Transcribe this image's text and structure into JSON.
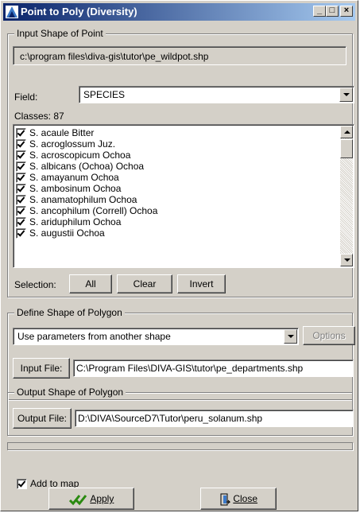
{
  "window": {
    "title": "Point to Poly  (Diversity)",
    "minimize": "_",
    "maximize": "□",
    "close": "×"
  },
  "input_point": {
    "legend": "Input Shape of Point",
    "path": "c:\\program files\\diva-gis\\tutor\\pe_wildpot.shp",
    "field_label": "Field:",
    "field_value": "SPECIES",
    "classes_label": "Classes: 87",
    "classes": [
      "S. acaule Bitter",
      "S. acroglossum Juz.",
      "S. acroscopicum Ochoa",
      "S. albicans (Ochoa) Ochoa",
      "S. amayanum Ochoa",
      "S. ambosinum Ochoa",
      "S. anamatophilum Ochoa",
      "S. ancophilum (Correll) Ochoa",
      "S. ariduphilum Ochoa",
      "S. augustii Ochoa"
    ],
    "selection_label": "Selection:",
    "btn_all": "All",
    "btn_clear": "Clear",
    "btn_invert": "Invert"
  },
  "polygon": {
    "legend": "Define Shape of Polygon",
    "method": "Use parameters from another shape",
    "options_label": "Options",
    "input_file_label": "Input File:",
    "input_file_value": "C:\\Program Files\\DIVA-GIS\\tutor\\pe_departments.shp"
  },
  "output": {
    "legend": "Output Shape of Polygon",
    "output_file_label": "Output File:",
    "output_file_value": "D:\\DIVA\\SourceD7\\Tutor\\peru_solanum.shp"
  },
  "add_to_map_label": "Add to map",
  "apply_label": "Apply",
  "close_label": "Close",
  "colors": {
    "titlebar": "#0a246a",
    "face": "#d4d0c8",
    "apply_check": "#2a8a10"
  }
}
